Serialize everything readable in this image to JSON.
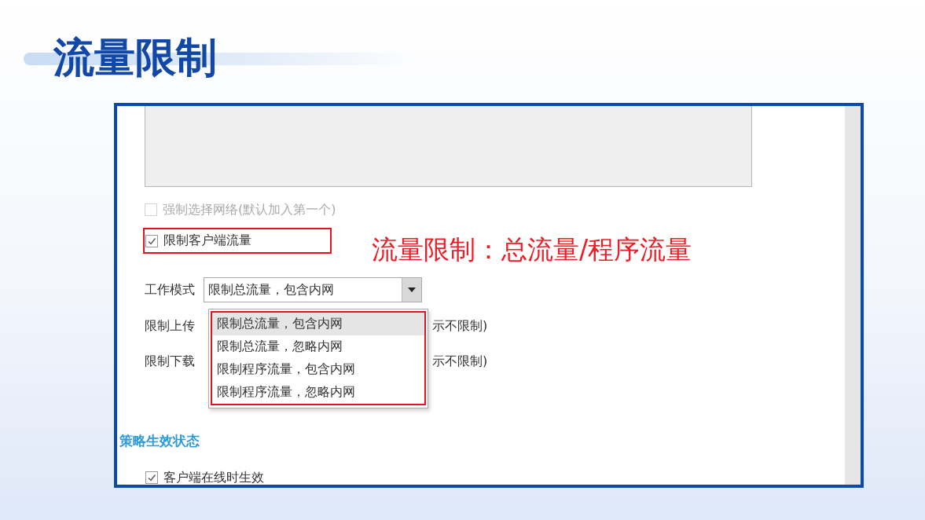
{
  "title": "流量限制",
  "annotation": "流量限制：总流量/程序流量",
  "options": [
    {
      "kind": "checkbox",
      "label": "强制选择网络(默认加入第一个)",
      "checked": false,
      "disabled": true,
      "highlighted": false
    },
    {
      "kind": "checkbox",
      "label": "限制客户端流量",
      "checked": true,
      "disabled": false,
      "highlighted": true
    }
  ],
  "work_mode": {
    "label": "工作模式",
    "value": "限制总流量，包含内网",
    "expanded": true,
    "highlighted": true,
    "options": [
      {
        "label": "限制总流量，包含内网",
        "selected": true
      },
      {
        "label": "限制总流量，忽略内网",
        "selected": false
      },
      {
        "label": "限制程序流量，包含内网",
        "selected": false
      },
      {
        "label": "限制程序流量，忽略内网",
        "selected": false
      }
    ]
  },
  "limits": [
    {
      "label": "限制上传",
      "hint": "示不限制)"
    },
    {
      "label": "限制下载",
      "hint": "示不限制)"
    }
  ],
  "section_title": "策略生效状态",
  "status_options": [
    {
      "kind": "checkbox",
      "label": "客户端在线时生效",
      "checked": true,
      "disabled": false
    }
  ]
}
